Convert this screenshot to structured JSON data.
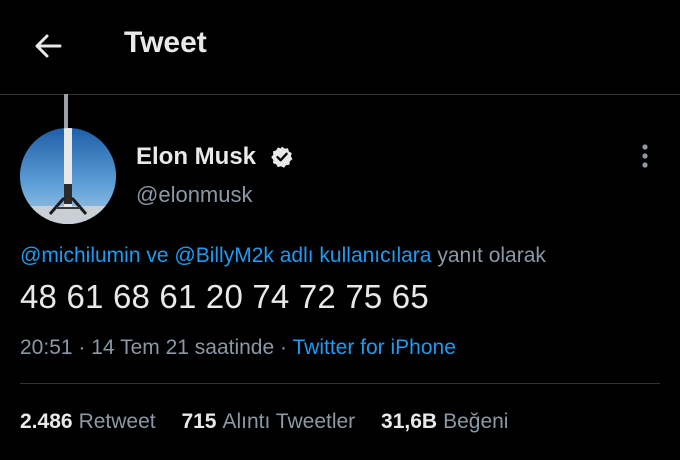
{
  "header": {
    "title": "Tweet",
    "back_icon": "arrow-left-icon"
  },
  "author": {
    "display_name": "Elon Musk",
    "username": "@elonmusk",
    "verified_icon": "verified-badge-icon",
    "avatar": "rocket-booster-avatar",
    "more_icon": "more-vertical-icon"
  },
  "reply": {
    "mention_1": "@michilumin",
    "connector": "ve",
    "mention_2": "@BillyM2k",
    "suffix_link": "adlı kullanıcılara",
    "suffix_text": "yanıt olarak"
  },
  "tweet": {
    "text": "48 61 68 61 20 74 72 75 65",
    "time": "20:51",
    "separator_1": "·",
    "date": "14 Tem 21 saatinde",
    "separator_2": "·",
    "source": "Twitter for iPhone"
  },
  "stats": {
    "retweets_count": "2.486",
    "retweets_label": "Retweet",
    "quotes_count": "715",
    "quotes_label": "Alıntı Tweetler",
    "likes_count": "31,6B",
    "likes_label": "Beğeni"
  },
  "colors": {
    "background": "#000000",
    "text": "#e7e9ea",
    "secondary": "#8b98a5",
    "accent": "#1d9bf0",
    "divider": "#2f3336"
  }
}
